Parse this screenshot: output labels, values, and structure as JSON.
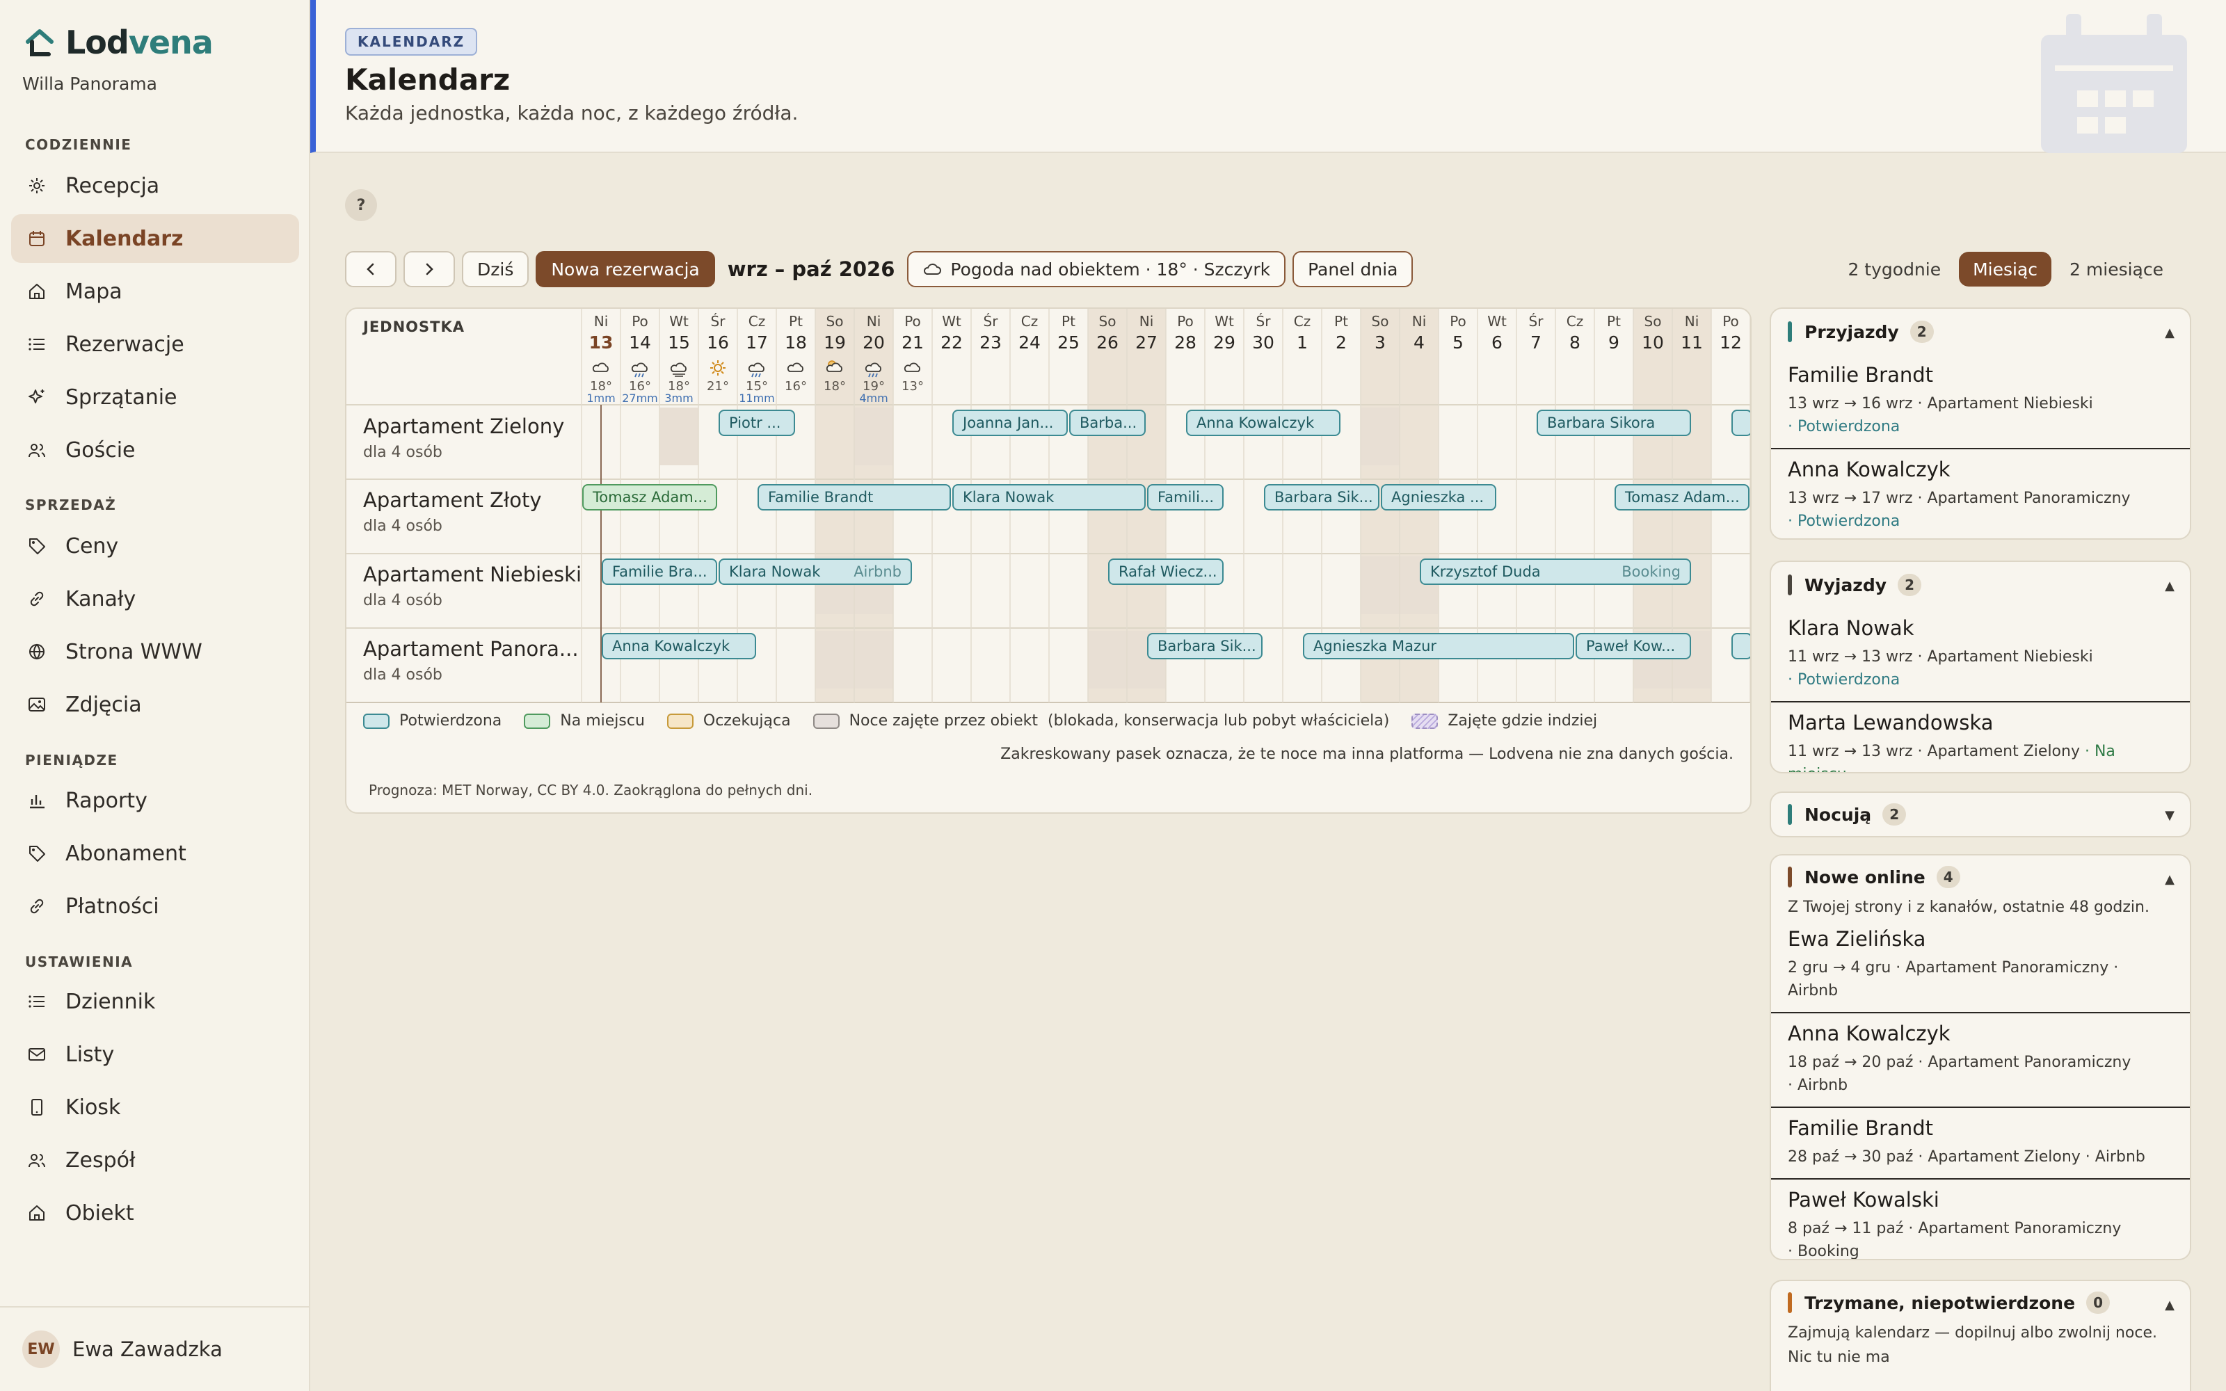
{
  "brand": {
    "name_a": "Lod",
    "name_b": "vena",
    "property": "Willa Panorama"
  },
  "nav": {
    "sections": [
      "CODZIENNIE",
      "SPRZEDAŻ",
      "PIENIĄDZE",
      "USTAWIENIA"
    ],
    "items": [
      {
        "label": "Recepcja",
        "icon": "sun-icon"
      },
      {
        "label": "Kalendarz",
        "icon": "calendar-icon",
        "active": true
      },
      {
        "label": "Mapa",
        "icon": "home-icon"
      },
      {
        "label": "Rezerwacje",
        "icon": "list-icon"
      },
      {
        "label": "Sprzątanie",
        "icon": "sparkle-icon"
      },
      {
        "label": "Goście",
        "icon": "users-icon"
      },
      {
        "label": "Ceny",
        "icon": "tag-icon"
      },
      {
        "label": "Kanały",
        "icon": "link-icon"
      },
      {
        "label": "Strona WWW",
        "icon": "globe-icon"
      },
      {
        "label": "Zdjęcia",
        "icon": "image-icon"
      },
      {
        "label": "Raporty",
        "icon": "bar-chart-icon"
      },
      {
        "label": "Abonament",
        "icon": "tag-icon"
      },
      {
        "label": "Płatności",
        "icon": "link-icon"
      },
      {
        "label": "Dziennik",
        "icon": "list-icon"
      },
      {
        "label": "Listy",
        "icon": "mail-icon"
      },
      {
        "label": "Kiosk",
        "icon": "tablet-icon"
      },
      {
        "label": "Zespół",
        "icon": "users-icon"
      },
      {
        "label": "Obiekt",
        "icon": "home-icon"
      }
    ],
    "user": {
      "initials": "EW",
      "name": "Ewa Zawadzka"
    }
  },
  "header": {
    "badge": "KALENDARZ",
    "title": "Kalendarz",
    "subtitle": "Każda jednostka, każda noc, z każdego źródła."
  },
  "help": "?",
  "toolbar": {
    "today": "Dziś",
    "new_booking": "Nowa rezerwacja",
    "range": "wrz – paź 2026",
    "weather": "Pogoda nad obiektem · 18° · Szczyrk",
    "day_panel": "Panel dnia",
    "views": [
      "2 tygodnie",
      "Miesiąc",
      "2 miesiące"
    ]
  },
  "calendar": {
    "unit_header": "JEDNOSTKA",
    "days": [
      {
        "dow": "Ni",
        "d": "13",
        "w": "cloud",
        "t": "18°",
        "r": "1mm",
        "today": true
      },
      {
        "dow": "Po",
        "d": "14",
        "w": "rain",
        "t": "16°",
        "r": "27mm"
      },
      {
        "dow": "Wt",
        "d": "15",
        "w": "fog",
        "t": "18°",
        "r": "3mm"
      },
      {
        "dow": "Śr",
        "d": "16",
        "w": "sun",
        "t": "21°",
        "r": ""
      },
      {
        "dow": "Cz",
        "d": "17",
        "w": "rain",
        "t": "15°",
        "r": "11mm"
      },
      {
        "dow": "Pt",
        "d": "18",
        "w": "cloud",
        "t": "16°",
        "r": ""
      },
      {
        "dow": "So",
        "d": "19",
        "w": "suncloud",
        "t": "18°",
        "r": "",
        "weekend": true
      },
      {
        "dow": "Ni",
        "d": "20",
        "w": "rain",
        "t": "19°",
        "r": "4mm",
        "weekend": true
      },
      {
        "dow": "Po",
        "d": "21",
        "w": "cloud",
        "t": "13°",
        "r": ""
      },
      {
        "dow": "Wt",
        "d": "22"
      },
      {
        "dow": "Śr",
        "d": "23"
      },
      {
        "dow": "Cz",
        "d": "24"
      },
      {
        "dow": "Pt",
        "d": "25"
      },
      {
        "dow": "So",
        "d": "26",
        "weekend": true
      },
      {
        "dow": "Ni",
        "d": "27",
        "weekend": true
      },
      {
        "dow": "Po",
        "d": "28"
      },
      {
        "dow": "Wt",
        "d": "29"
      },
      {
        "dow": "Śr",
        "d": "30"
      },
      {
        "dow": "Cz",
        "d": "1"
      },
      {
        "dow": "Pt",
        "d": "2"
      },
      {
        "dow": "So",
        "d": "3",
        "weekend": true
      },
      {
        "dow": "Ni",
        "d": "4",
        "weekend": true
      },
      {
        "dow": "Po",
        "d": "5"
      },
      {
        "dow": "Wt",
        "d": "6"
      },
      {
        "dow": "Śr",
        "d": "7"
      },
      {
        "dow": "Cz",
        "d": "8"
      },
      {
        "dow": "Pt",
        "d": "9"
      },
      {
        "dow": "So",
        "d": "10",
        "weekend": true
      },
      {
        "dow": "Ni",
        "d": "11",
        "weekend": true
      },
      {
        "dow": "Po",
        "d": "12"
      }
    ],
    "units": [
      {
        "name": "Apartament Zielony",
        "cap": "dla 4 osób",
        "blocked": [
          [
            2,
            3
          ],
          [
            7,
            8
          ],
          [
            20,
            21
          ]
        ],
        "bookings": [
          {
            "label": "Piotr ...",
            "start": 3.5,
            "end": 5.5,
            "status": "confirmed"
          },
          {
            "label": "Joanna Jan...",
            "start": 9.5,
            "end": 12.5,
            "status": "confirmed"
          },
          {
            "label": "Barba...",
            "start": 12.5,
            "end": 14.5,
            "status": "confirmed"
          },
          {
            "label": "Anna Kowalczyk",
            "start": 15.5,
            "end": 19.5,
            "status": "confirmed"
          },
          {
            "label": "Barbara Sikora",
            "start": 24.5,
            "end": 28.5,
            "status": "confirmed"
          },
          {
            "label": "",
            "start": 29.5,
            "end": 31,
            "status": "confirmed"
          }
        ]
      },
      {
        "name": "Apartament Złoty",
        "cap": "dla 4 osób",
        "blocked": [],
        "bookings": [
          {
            "label": "Tomasz Adam...",
            "start": 0,
            "end": 3.5,
            "status": "onsite"
          },
          {
            "label": "Familie Brandt",
            "start": 4.5,
            "end": 9.5,
            "status": "confirmed"
          },
          {
            "label": "Klara Nowak",
            "start": 9.5,
            "end": 14.5,
            "status": "confirmed"
          },
          {
            "label": "Famili...",
            "start": 14.5,
            "end": 16.5,
            "status": "confirmed"
          },
          {
            "label": "Barbara Sik...",
            "start": 17.5,
            "end": 20.5,
            "status": "confirmed"
          },
          {
            "label": "Agnieszka ...",
            "start": 20.5,
            "end": 23.5,
            "status": "confirmed"
          },
          {
            "label": "Tomasz Adam...",
            "start": 26.5,
            "end": 30,
            "status": "confirmed"
          }
        ]
      },
      {
        "name": "Apartament Niebieski",
        "cap": "dla 4 osób",
        "blocked": [
          [
            6,
            8
          ],
          [
            20,
            22
          ]
        ],
        "bookings": [
          {
            "label": "Familie Bra...",
            "start": 0.5,
            "end": 3.5,
            "status": "confirmed"
          },
          {
            "label": "Klara Nowak",
            "channel": "Airbnb",
            "start": 3.5,
            "end": 8.5,
            "status": "confirmed"
          },
          {
            "label": "Rafał Wiecz...",
            "start": 13.5,
            "end": 16.5,
            "status": "confirmed"
          },
          {
            "label": "Krzysztof Duda",
            "channel": "Booking",
            "start": 21.5,
            "end": 28.5,
            "status": "confirmed"
          }
        ]
      },
      {
        "name": "Apartament Panora...",
        "cap": "dla 4 osób",
        "blocked": [
          [
            6,
            8
          ],
          [
            13,
            15
          ],
          [
            27,
            29
          ]
        ],
        "bookings": [
          {
            "label": "Anna Kowalczyk",
            "start": 0.5,
            "end": 4.5,
            "status": "confirmed"
          },
          {
            "label": "Barbara Sik...",
            "start": 14.5,
            "end": 17.5,
            "status": "confirmed"
          },
          {
            "label": "Agnieszka Mazur",
            "start": 18.5,
            "end": 25.5,
            "status": "confirmed"
          },
          {
            "label": "Paweł Kow...",
            "start": 25.5,
            "end": 28.5,
            "status": "confirmed"
          },
          {
            "label": "",
            "start": 29.5,
            "end": 31,
            "status": "confirmed"
          }
        ]
      }
    ],
    "legend": [
      {
        "label": "Potwierdzona",
        "fill": "#cfe7ea",
        "stroke": "#3c8a92"
      },
      {
        "label": "Na miejscu",
        "fill": "#d5ecd6",
        "stroke": "#4f9a5e"
      },
      {
        "label": "Oczekująca",
        "fill": "#f6e6c7",
        "stroke": "#c79a3a"
      },
      {
        "label": "Noce zajęte przez obiekt  (blokada, konserwacja lub pobyt właściciela)",
        "fill": "#e6e0dc",
        "stroke": "#8f8a86"
      },
      {
        "label": "Zajęte gdzie indziej",
        "fill": "#e6def2",
        "stroke": "#9d8ec0"
      }
    ],
    "legend_note": "Zakreskowany pasek oznacza, że te noce ma inna platforma — Lodvena nie zna danych gościa.",
    "forecast_note": "Prognoza: MET Norway, CC BY 4.0. Zaokrąglona do pełnych dni."
  },
  "panels": {
    "arrivals": {
      "title": "Przyjazdy",
      "count": "2",
      "color": "#2e7d7a",
      "items": [
        {
          "name": "Familie Brandt",
          "meta": "13 wrz → 16 wrz  · Apartament Niebieski",
          "status": "· Potwierdzona"
        },
        {
          "name": "Anna Kowalczyk",
          "meta": "13 wrz → 17 wrz  · Apartament Panoramiczny",
          "status": "· Potwierdzona"
        }
      ]
    },
    "departures": {
      "title": "Wyjazdy",
      "count": "2",
      "color": "#4a453e",
      "items": [
        {
          "name": "Klara Nowak",
          "meta": "11 wrz → 13 wrz  · Apartament Niebieski",
          "status": "· Potwierdzona"
        },
        {
          "name": "Marta Lewandowska",
          "meta": "11 wrz → 13 wrz  · Apartament Zielony",
          "status": "· Na miejscu"
        }
      ]
    },
    "staying": {
      "title": "Nocują",
      "count": "2",
      "color": "#2e7d7a"
    },
    "new_online": {
      "title": "Nowe online",
      "count": "4",
      "color": "#7c4a2a",
      "desc": "Z Twojej strony i z kanałów, ostatnie 48 godzin.",
      "items": [
        {
          "name": "Ewa Zielińska",
          "meta": "2 gru → 4 gru  · Apartament Panoramiczny  · Airbnb"
        },
        {
          "name": "Anna Kowalczyk",
          "meta": "18 paź → 20 paź  · Apartament Panoramiczny",
          "meta2": "· Airbnb"
        },
        {
          "name": "Familie Brandt",
          "meta": "28 paź → 30 paź  · Apartament Zielony  · Airbnb"
        },
        {
          "name": "Paweł Kowalski",
          "meta": "8 paź → 11 paź  · Apartament Panoramiczny",
          "meta2": "· Booking"
        }
      ]
    },
    "held": {
      "title": "Trzymane, niepotwierdzone",
      "count": "0",
      "color": "#c06a20",
      "desc": "Zajmują kalendarz — dopilnuj albo zwolnij noce.",
      "empty": "Nic tu nie ma"
    }
  }
}
